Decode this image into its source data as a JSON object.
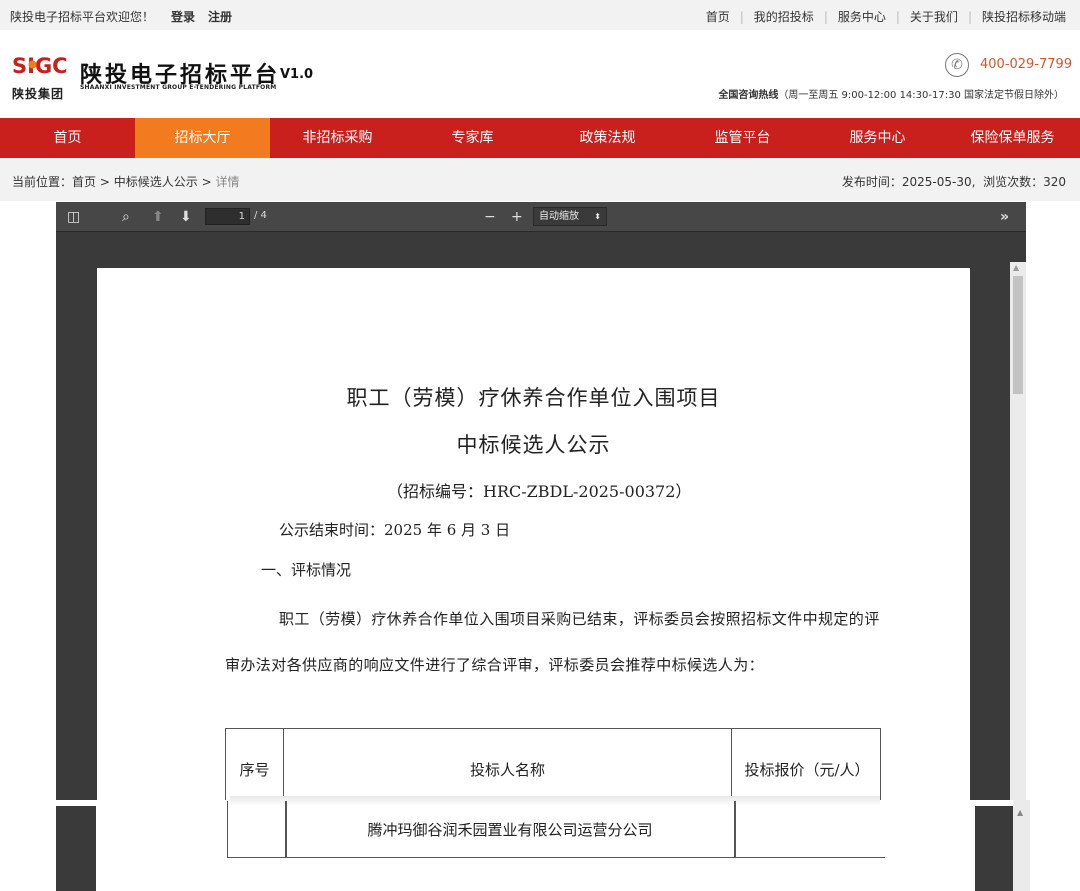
{
  "topbar": {
    "welcome": "陕投电子招标平台欢迎您！",
    "login": "登录",
    "register": "注册",
    "links": [
      "首页",
      "我的招投标",
      "服务中心",
      "关于我们",
      "陕投招标移动端"
    ]
  },
  "header": {
    "logo_mark": "SIGC",
    "logo_group": "陕投集团",
    "title": "陕投电子招标平台",
    "version": "V1.0",
    "title_en": "SHAANXI INVESTMENT GROUP E-TENDERING PLATFORM",
    "phone": "400-029-7799",
    "hotline_label": "全国咨询热线",
    "hotline_hours": "（周一至周五 9:00-12:00 14:30-17:30 国家法定节假日除外）"
  },
  "nav": {
    "items": [
      "首页",
      "招标大厅",
      "非招标采购",
      "专家库",
      "政策法规",
      "监管平台",
      "服务中心",
      "保险保单服务"
    ],
    "active_index": 1
  },
  "breadcrumb": {
    "prefix": "当前位置：",
    "home": "首页",
    "section": "中标候选人公示",
    "current": "详情",
    "sep": ">",
    "publish": "发布时间：2025-05-30,",
    "views": "浏览次数：320"
  },
  "viewer": {
    "page_current": "1",
    "page_total": "/ 4",
    "zoom": "自动缩放"
  },
  "document": {
    "title_line1": "职工（劳模）疗休养合作单位入围项目",
    "title_line2": "中标候选人公示",
    "code": "（招标编号：HRC-ZBDL-2025-00372）",
    "end_time": "公示结束时间：2025 年 6 月 3 日",
    "section1": "一、评标情况",
    "paragraph": "职工（劳模）疗休养合作单位入围项目采购已结束，评标委员会按照招标文件中规定的评审办法对各供应商的响应文件进行了综合评审，评标委员会推荐中标候选人为：",
    "table_headers": [
      "序号",
      "投标人名称",
      "投标报价（元/人）"
    ],
    "row1_name": "腾冲玛御谷润禾园置业有限公司运营分公司"
  },
  "colors": {
    "nav_red": "#c9201e",
    "nav_active": "#f27b1f",
    "phone_orange": "#d9532a"
  }
}
